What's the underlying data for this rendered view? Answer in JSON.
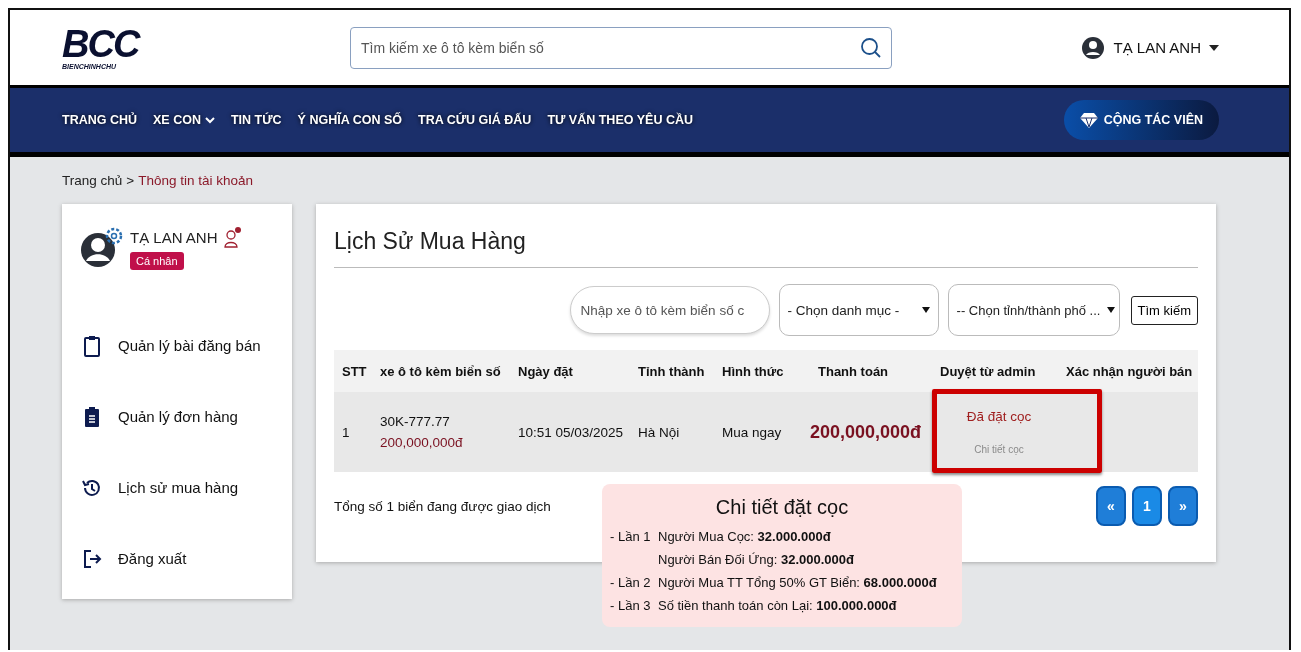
{
  "header": {
    "logo": {
      "mark": "BCC",
      "tagline": "BIENCHINHCHU"
    },
    "search": {
      "placeholder": "Tìm kiếm xe ô tô kèm biển số"
    },
    "user": {
      "name": "TẠ LAN ANH"
    }
  },
  "nav": {
    "items": [
      {
        "label": "TRANG CHỦ",
        "dropdown": false
      },
      {
        "label": "XE CON",
        "dropdown": true
      },
      {
        "label": "TIN TỨC",
        "dropdown": false
      },
      {
        "label": "Ý NGHĨA CON SỐ",
        "dropdown": false
      },
      {
        "label": "TRA CỨU GIÁ ĐẤU",
        "dropdown": false
      },
      {
        "label": "TƯ VẤN THEO YÊU CẦU",
        "dropdown": false
      }
    ],
    "partner_button": "CỘNG TÁC VIÊN"
  },
  "breadcrumb": [
    "Trang chủ",
    ">",
    "Thông tin tài khoản"
  ],
  "sidebar": {
    "profile": {
      "name": "TẠ LAN ANH",
      "badge": "Cá nhân"
    },
    "items": [
      {
        "label": "Quản lý bài đăng bán",
        "selected": false
      },
      {
        "label": "Quản lý đơn hàng",
        "selected": false
      },
      {
        "label": "Lịch sử mua hàng",
        "selected": false
      },
      {
        "label": "Đăng xuất",
        "selected": false
      }
    ]
  },
  "main": {
    "title": "Lịch Sử Mua Hàng",
    "filters": {
      "search_placeholder": "Nhập xe ô tô kèm biển số c",
      "category": "- Chọn danh mục -",
      "province": "-- Chọn tỉnh/thành phố ...",
      "button": "Tìm kiếm"
    },
    "table": {
      "columns": [
        "STT",
        "xe ô tô kèm biển số",
        "Ngày đặt",
        "Tỉnh thành",
        "Hình thức",
        "Thanh toán",
        "Duyệt từ admin",
        "Xác nhận người bán"
      ],
      "rows": [
        {
          "stt": "1",
          "plate": "30K-777.77",
          "plate_price": "200,000,000đ",
          "date": "10:51 05/03/2025",
          "province": "Hà Nội",
          "method": "Mua ngay",
          "payment": "200,000,000đ",
          "admin_status": "Đã đặt cọc",
          "admin_link": "Chi tiết cọc",
          "highlighted": true
        }
      ]
    },
    "summary": "Tổng số 1 biển đang được giao dịch",
    "pagination": [
      {
        "label": "«",
        "selected": false
      },
      {
        "label": "1",
        "selected": true
      },
      {
        "label": "»",
        "selected": false
      }
    ],
    "deposit_popup": {
      "title": "Chi tiết đặt cọc",
      "lines": [
        {
          "step": "- Lần 1",
          "text": "Người Mua Cọc: **32.000.000đ**"
        },
        {
          "text": "Người Bán Đối Ứng: **32.000.000đ**"
        },
        {
          "step": "- Lần 2",
          "text": "Người Mua TT Tổng 50% GT Biển: **68.000.000đ**"
        },
        {
          "step": "- Lần 3",
          "text": "Số tiền thanh toán còn Lại: **100.000.000đ**"
        }
      ]
    }
  }
}
